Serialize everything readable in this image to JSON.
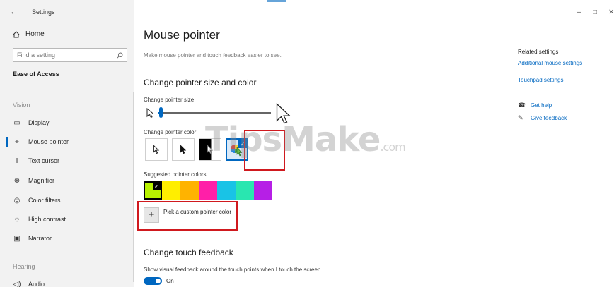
{
  "window": {
    "title": "Settings",
    "controls": {
      "minimize": "–",
      "maximize": "□",
      "close": "✕"
    }
  },
  "sidebar": {
    "home": "Home",
    "search_placeholder": "Find a setting",
    "section": "Ease of Access",
    "groups": [
      {
        "label": "Vision",
        "items": [
          {
            "label": "Display",
            "icon": "monitor-icon"
          },
          {
            "label": "Mouse pointer",
            "icon": "mouse-pointer-icon",
            "active": true
          },
          {
            "label": "Text cursor",
            "icon": "text-cursor-icon"
          },
          {
            "label": "Magnifier",
            "icon": "magnifier-icon"
          },
          {
            "label": "Color filters",
            "icon": "color-filters-icon"
          },
          {
            "label": "High contrast",
            "icon": "high-contrast-icon"
          },
          {
            "label": "Narrator",
            "icon": "narrator-icon"
          }
        ]
      },
      {
        "label": "Hearing",
        "items": [
          {
            "label": "Audio",
            "icon": "audio-icon"
          }
        ]
      }
    ]
  },
  "main": {
    "title": "Mouse pointer",
    "subtitle": "Make mouse pointer and touch feedback easier to see.",
    "size_color_heading": "Change pointer size and color",
    "pointer_size_label": "Change pointer size",
    "pointer_size_value": 0.03,
    "pointer_color_label": "Change pointer color",
    "pointer_color_options": [
      "White",
      "Black",
      "Inverted",
      "Custom"
    ],
    "pointer_color_selected": "Custom",
    "suggested_label": "Suggested pointer colors",
    "suggested_colors": [
      "#b8f200",
      "#ffee00",
      "#ffb300",
      "#ff1fa8",
      "#19c3e6",
      "#29e6b0",
      "#b61fe6"
    ],
    "suggested_selected_index": 0,
    "pick_custom_label": "Pick a custom pointer color",
    "touch_heading": "Change touch feedback",
    "touch_desc": "Show visual feedback around the touch points when I touch the screen",
    "touch_toggle_state": "On",
    "accent_color": "#0067c0",
    "highlight_color": "#d0191e"
  },
  "related": {
    "title": "Related settings",
    "links": [
      "Additional mouse settings",
      "Touchpad settings"
    ],
    "help": "Get help",
    "feedback": "Give feedback"
  },
  "watermark": {
    "brand": "TipsMake",
    "suffix": ".com"
  }
}
